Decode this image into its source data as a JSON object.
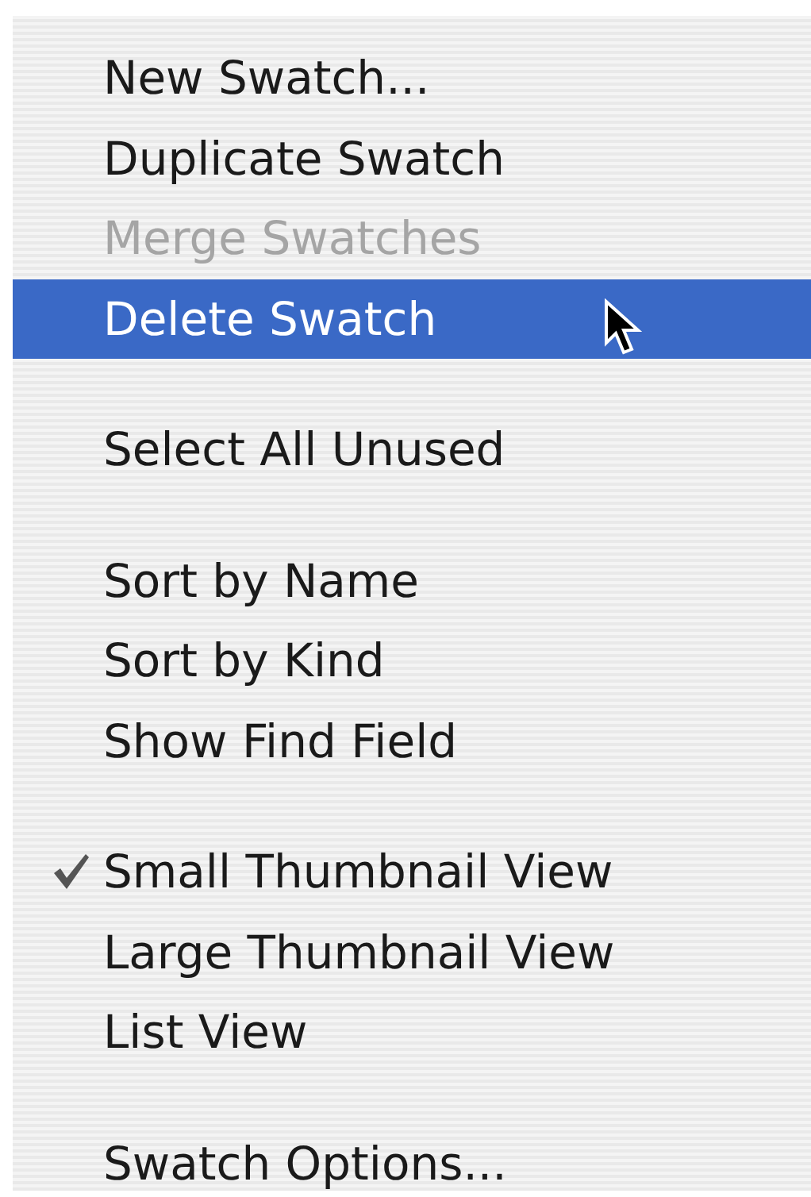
{
  "menu": {
    "items": [
      {
        "kind": "item",
        "label": "New Swatch...",
        "disabled": false,
        "selected": false,
        "checked": false
      },
      {
        "kind": "item",
        "label": "Duplicate Swatch",
        "disabled": false,
        "selected": false,
        "checked": false
      },
      {
        "kind": "item",
        "label": "Merge Swatches",
        "disabled": true,
        "selected": false,
        "checked": false
      },
      {
        "kind": "item",
        "label": "Delete Swatch",
        "disabled": false,
        "selected": true,
        "checked": false
      },
      {
        "kind": "separator"
      },
      {
        "kind": "item",
        "label": "Select All Unused",
        "disabled": false,
        "selected": false,
        "checked": false
      },
      {
        "kind": "separator"
      },
      {
        "kind": "item",
        "label": "Sort by Name",
        "disabled": false,
        "selected": false,
        "checked": false
      },
      {
        "kind": "item",
        "label": "Sort by Kind",
        "disabled": false,
        "selected": false,
        "checked": false
      },
      {
        "kind": "item",
        "label": "Show Find Field",
        "disabled": false,
        "selected": false,
        "checked": false
      },
      {
        "kind": "separator"
      },
      {
        "kind": "item",
        "label": "Small Thumbnail View",
        "disabled": false,
        "selected": false,
        "checked": true
      },
      {
        "kind": "item",
        "label": "Large Thumbnail View",
        "disabled": false,
        "selected": false,
        "checked": false
      },
      {
        "kind": "item",
        "label": "List View",
        "disabled": false,
        "selected": false,
        "checked": false
      },
      {
        "kind": "separator"
      },
      {
        "kind": "item",
        "label": "Swatch Options...",
        "disabled": false,
        "selected": false,
        "checked": false
      }
    ]
  }
}
